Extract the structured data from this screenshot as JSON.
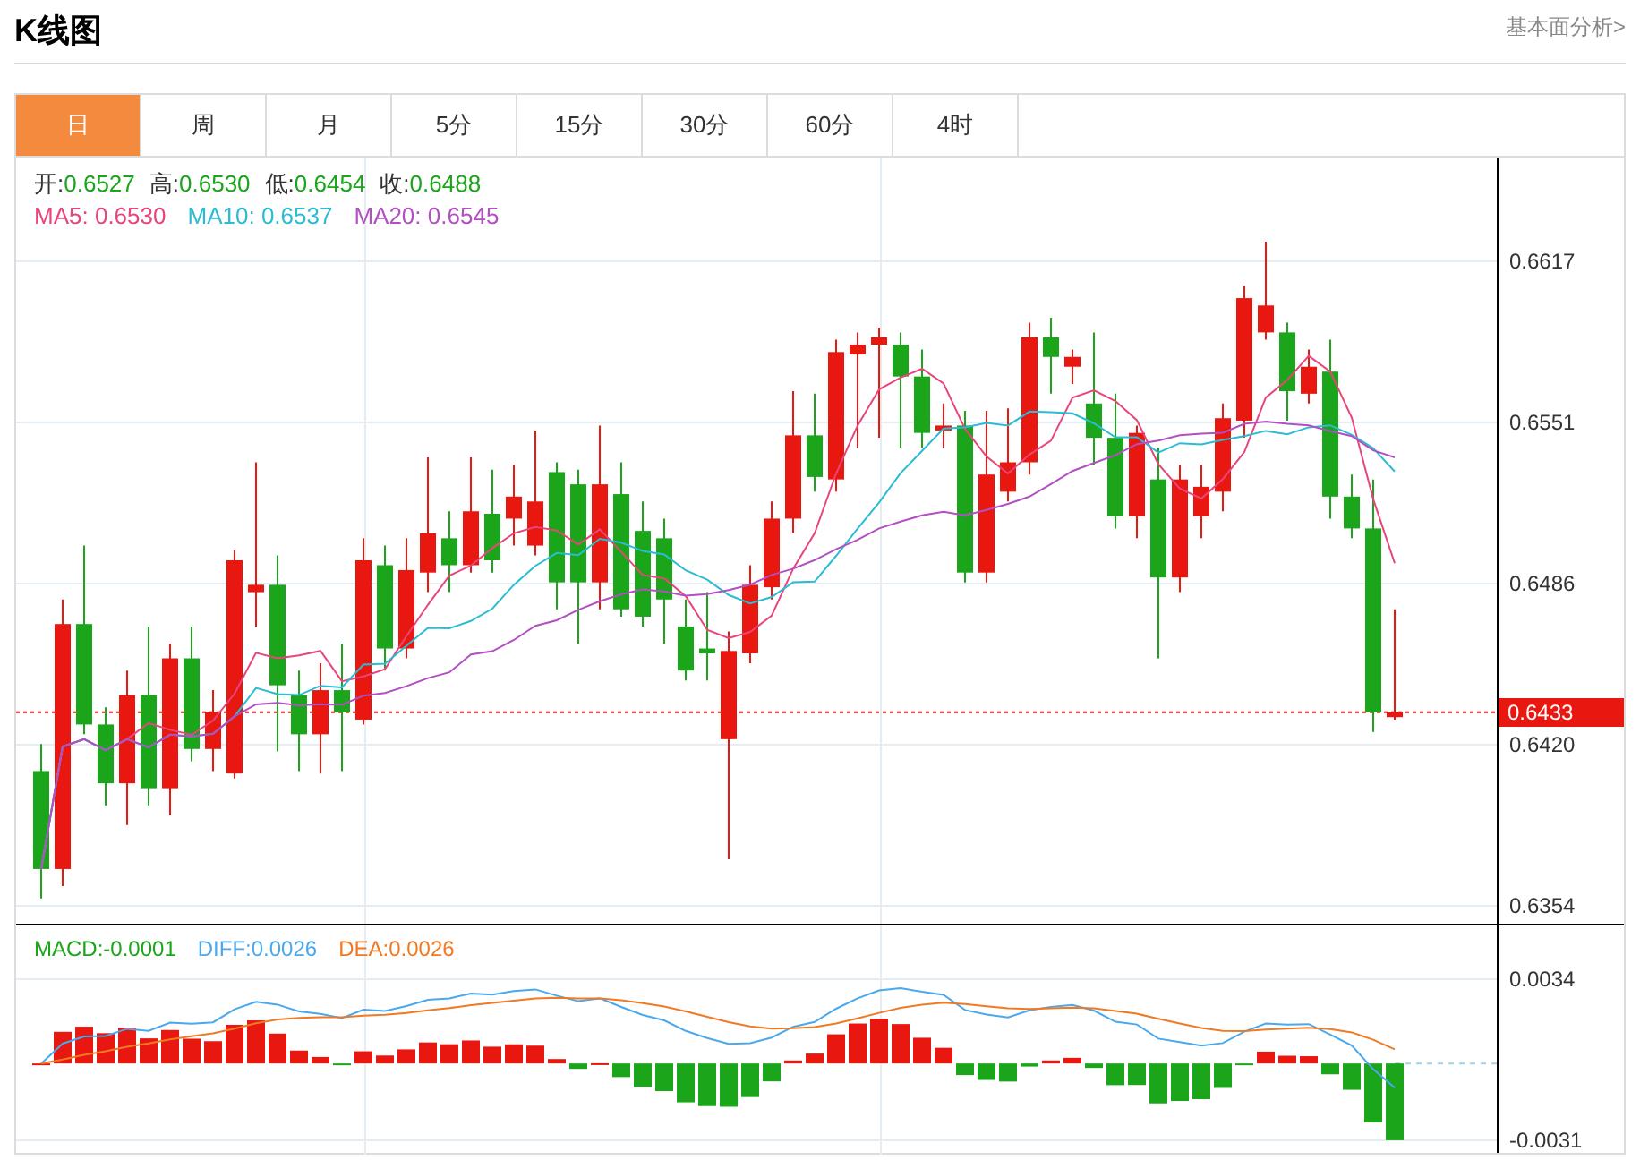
{
  "header": {
    "title": "K线图",
    "link": "基本面分析>"
  },
  "tabs": [
    {
      "label": "日",
      "selected": true
    },
    {
      "label": "周",
      "selected": false
    },
    {
      "label": "月",
      "selected": false
    },
    {
      "label": "5分",
      "selected": false
    },
    {
      "label": "15分",
      "selected": false
    },
    {
      "label": "30分",
      "selected": false
    },
    {
      "label": "60分",
      "selected": false
    },
    {
      "label": "4时",
      "selected": false
    }
  ],
  "price_panel": {
    "quote": [
      {
        "label": "开:",
        "value": "0.6527"
      },
      {
        "label": "高:",
        "value": "0.6530"
      },
      {
        "label": "低:",
        "value": "0.6454"
      },
      {
        "label": "收:",
        "value": "0.6488"
      }
    ],
    "moving_averages": [
      {
        "label": "MA5:",
        "value": "0.6530",
        "color": "#e8457c"
      },
      {
        "label": "MA10:",
        "value": "0.6537",
        "color": "#2bbcd4"
      },
      {
        "label": "MA20:",
        "value": "0.6545",
        "color": "#b24fc2"
      }
    ],
    "axis_labels": [
      "0.6617",
      "0.6551",
      "0.6486",
      "0.6420",
      "0.6354"
    ],
    "current_price_label": "0.6433"
  },
  "macd_panel": {
    "readouts": [
      {
        "label": "MACD:",
        "value": "-0.0001",
        "color": "#1aa51a"
      },
      {
        "label": "DIFF:",
        "value": "0.0026",
        "color": "#4aa8ec"
      },
      {
        "label": "DEA:",
        "value": "0.0026",
        "color": "#f07a23"
      }
    ],
    "axis_labels": [
      "0.0034",
      "-0.0031"
    ]
  }
}
